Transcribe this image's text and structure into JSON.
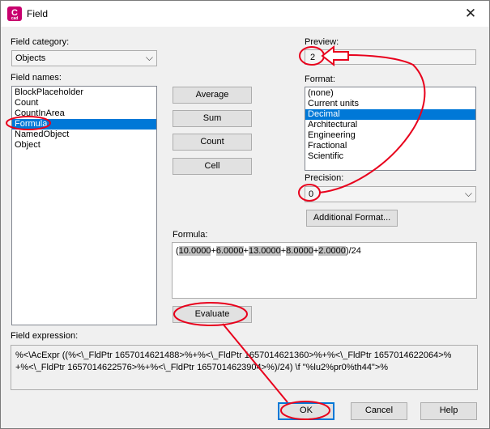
{
  "window": {
    "title": "Field",
    "app_icon_letter": "C",
    "app_icon_sub": "cad"
  },
  "field_category": {
    "label": "Field category:",
    "value": "Objects"
  },
  "field_names": {
    "label": "Field names:",
    "items": [
      "BlockPlaceholder",
      "Count",
      "CountInArea",
      "Formula",
      "NamedObject",
      "Object"
    ],
    "selected": "Formula"
  },
  "formula_buttons": {
    "average": "Average",
    "sum": "Sum",
    "count": "Count",
    "cell": "Cell"
  },
  "preview": {
    "label": "Preview:",
    "value": "2"
  },
  "format": {
    "label": "Format:",
    "items": [
      "(none)",
      "Current units",
      "Decimal",
      "Architectural",
      "Engineering",
      "Fractional",
      "Scientific"
    ],
    "selected": "Decimal"
  },
  "precision": {
    "label": "Precision:",
    "value": "0"
  },
  "additional_format_button": "Additional Format...",
  "formula": {
    "label": "Formula:",
    "parts": {
      "open": "(",
      "v1": "10.0000",
      "p1": "+",
      "v2": "6.0000",
      "p2": "+",
      "v3": "13.0000",
      "p3": "+",
      "v4": "8.0000",
      "p4": "+",
      "v5": "2.0000",
      "close": ")/24"
    }
  },
  "evaluate_button": "Evaluate",
  "field_expression": {
    "label": "Field expression:",
    "line1": "%<\\AcExpr ((%<\\_FldPtr 1657014621488>%+%<\\_FldPtr 1657014621360>%+%<\\_FldPtr 1657014622064>%",
    "line2": "+%<\\_FldPtr 1657014622576>%+%<\\_FldPtr 1657014623904>%)/24) \\f \"%lu2%pr0%th44\">%"
  },
  "dialog_buttons": {
    "ok": "OK",
    "cancel": "Cancel",
    "help": "Help"
  },
  "annotation_color": "#e8001c"
}
